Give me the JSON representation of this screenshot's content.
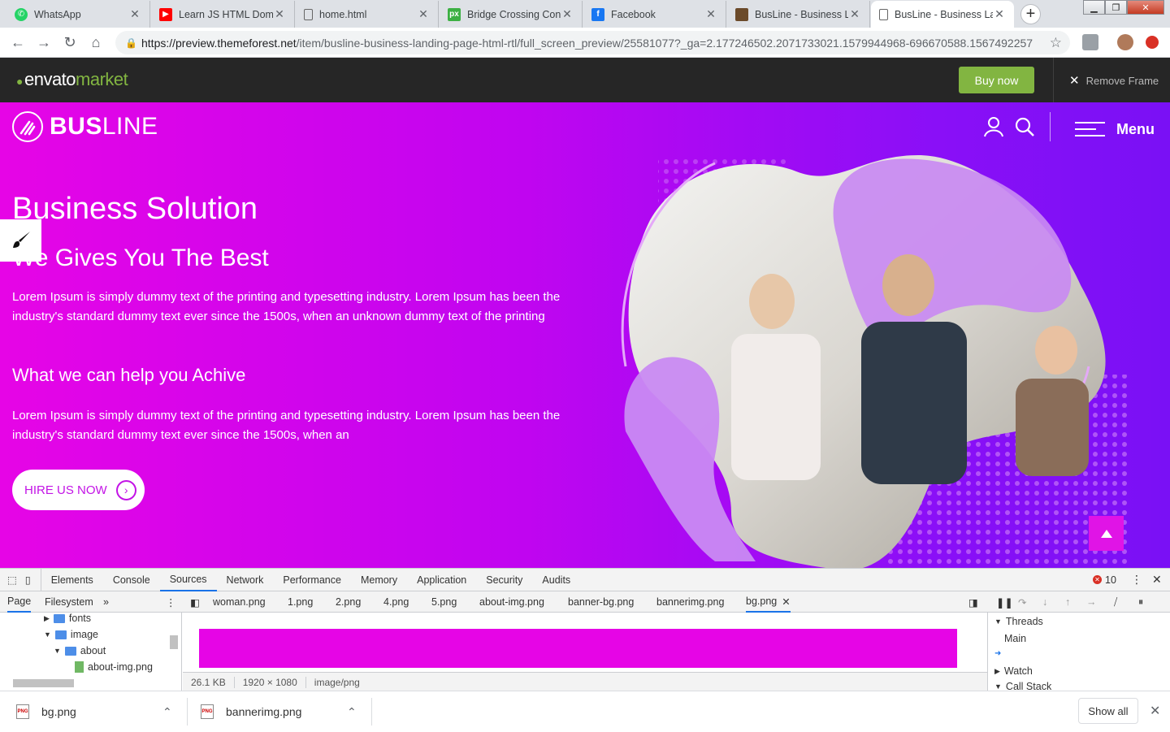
{
  "browser": {
    "tabs": [
      {
        "label": "WhatsApp",
        "icon": "whatsapp-icon",
        "color": "#25d366"
      },
      {
        "label": "Learn JS HTML Dom T",
        "icon": "youtube-icon",
        "color": "#ff0000"
      },
      {
        "label": "home.html",
        "icon": "file-icon",
        "color": "#ffffff"
      },
      {
        "label": "Bridge Crossing Conc",
        "icon": "px-icon",
        "color": "#3cb043"
      },
      {
        "label": "Facebook",
        "icon": "facebook-icon",
        "color": "#1877f2"
      },
      {
        "label": "BusLine - Business La",
        "icon": "busline-icon",
        "color": "#6b4a2a"
      },
      {
        "label": "BusLine - Business La",
        "icon": "file-icon",
        "color": "#ffffff"
      }
    ],
    "url_host": "https://preview.themeforest.net",
    "url_path": "/item/busline-business-landing-page-html-rtl/full_screen_preview/25581077?_ga=2.177246502.2071733021.1579944968-696670588.1567492257"
  },
  "envato": {
    "logo_main": "envato",
    "logo_market": "market",
    "buy_label": "Buy now",
    "remove_label": "Remove Frame",
    "accent": "#82b541"
  },
  "site": {
    "logo_bold": "BUS",
    "logo_light": "LINE",
    "menu_label": "Menu",
    "hero_title": "Business Solution",
    "hero_subtitle": "We Gives You The Best",
    "para1": "Lorem Ipsum is simply dummy text of the printing and typesetting industry. Lorem Ipsum has been the industry's standard dummy text ever since the 1500s, when an unknown dummy text of the printing",
    "heading2": "What we can help you Achive",
    "para2": "Lorem Ipsum is simply dummy text of the printing and typesetting industry. Lorem Ipsum has been the industry's standard dummy text ever since the 1500s, when an",
    "cta_label": "HIRE US NOW",
    "gradient_start": "#e605e6",
    "gradient_end": "#7a10f5"
  },
  "devtools": {
    "tabs": [
      "Elements",
      "Console",
      "Sources",
      "Network",
      "Performance",
      "Memory",
      "Application",
      "Security",
      "Audits"
    ],
    "active_tab": "Sources",
    "error_count": "10",
    "nav_tabs": [
      "Page",
      "Filesystem"
    ],
    "files": [
      "woman.png",
      "1.png",
      "2.png",
      "4.png",
      "5.png",
      "about-img.png",
      "banner-bg.png",
      "bannerimg.png",
      "bg.png"
    ],
    "active_file": "bg.png",
    "tree": [
      "fonts",
      "image",
      "about",
      "about-img.png"
    ],
    "file_size": "26.1 KB",
    "dimensions": "1920 × 1080",
    "mime": "image/png",
    "debug_threads": "Threads",
    "debug_main": "Main",
    "debug_watch": "Watch",
    "debug_callstack": "Call Stack"
  },
  "downloads": {
    "items": [
      "bg.png",
      "bannerimg.png"
    ],
    "show_all": "Show all"
  }
}
